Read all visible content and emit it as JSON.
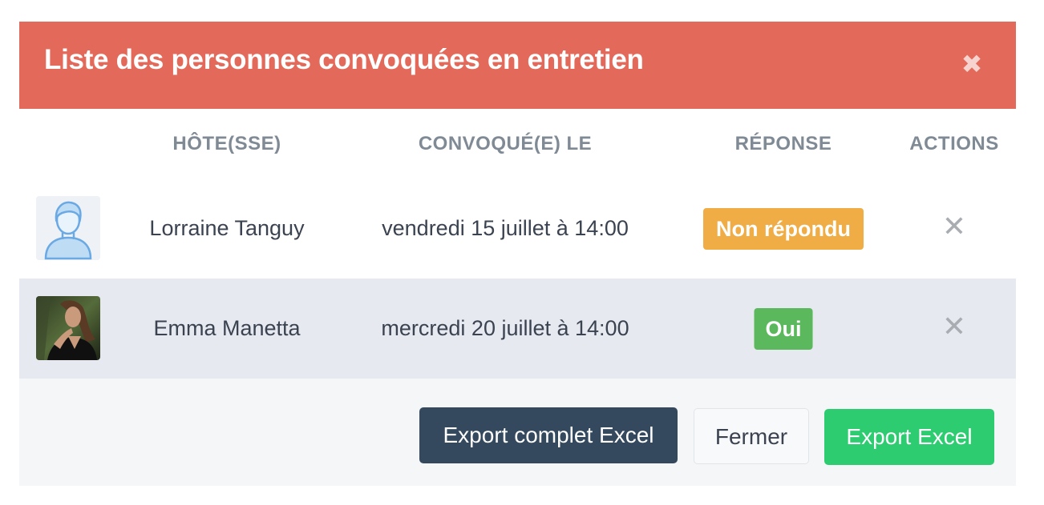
{
  "modal": {
    "title": "Liste des personnes convoquées en entretien",
    "close_icon": "close-icon",
    "columns": {
      "host": "HÔTE(SSE)",
      "date": "CONVOQUÉ(E) LE",
      "response": "RÉPONSE",
      "actions": "ACTIONS"
    },
    "rows": [
      {
        "avatar": "default-user-avatar",
        "name": "Lorraine Tanguy",
        "date": "vendredi 15 juillet à 14:00",
        "response": "Non répondu",
        "response_color": "#f0ac45",
        "action_icon": "remove-icon",
        "action_glyph": "✕"
      },
      {
        "avatar": "photo-avatar",
        "name": "Emma Manetta",
        "date": "mercredi 20 juillet à 14:00",
        "response": "Oui",
        "response_color": "#5cb85c",
        "action_icon": "remove-icon",
        "action_glyph": "✕"
      }
    ],
    "footer": {
      "export_full_label": "Export complet Excel",
      "close_label": "Fermer",
      "export_label": "Export Excel"
    },
    "colors": {
      "header_bg": "#e3695a",
      "dark_button": "#34495e",
      "green_button": "#2ecc71"
    }
  }
}
